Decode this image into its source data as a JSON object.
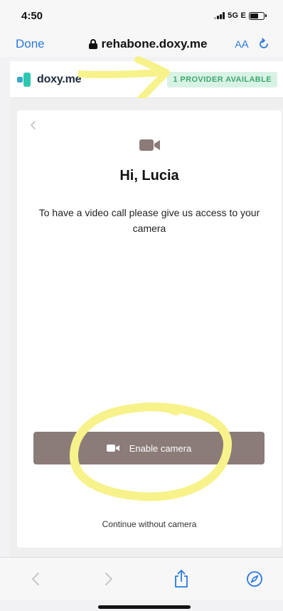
{
  "status_bar": {
    "time": "4:50",
    "network": "5G E"
  },
  "browser": {
    "done_label": "Done",
    "url": "rehabone.doxy.me",
    "text_size_label_small": "A",
    "text_size_label_large": "A"
  },
  "site_header": {
    "logo_text": "doxy.me",
    "provider_badge": "1 PROVIDER AVAILABLE"
  },
  "main": {
    "greeting": "Hi, Lucia",
    "message": "To have a video call please give us access to your camera",
    "enable_camera_label": "Enable camera",
    "continue_label": "Continue without camera"
  },
  "colors": {
    "accent_blue": "#2a7ae2",
    "badge_bg": "#d9f2e6",
    "badge_text": "#3fa86f",
    "button_bg": "#8b7b79",
    "annotation": "#f7f28a"
  },
  "icons": {
    "back": "chevron-left-icon",
    "video": "video-camera-icon",
    "lock": "lock-icon",
    "reload": "reload-icon",
    "share": "share-icon",
    "compass": "compass-icon"
  }
}
